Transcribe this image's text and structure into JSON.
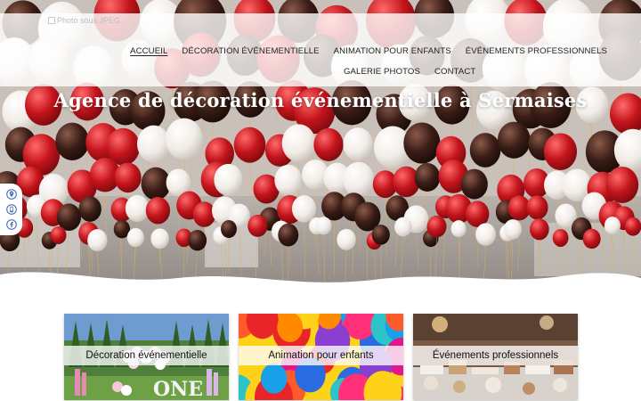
{
  "header": {
    "logo_alt": "Photo sous JPEG"
  },
  "nav": {
    "row1": [
      {
        "label": "Accueil",
        "active": true
      },
      {
        "label": "Décoration événementielle",
        "active": false
      },
      {
        "label": "Animation pour enfants",
        "active": false
      },
      {
        "label": "Événements professionnels",
        "active": false
      }
    ],
    "row2": [
      {
        "label": "Galerie photos",
        "active": false
      },
      {
        "label": "Contact",
        "active": false
      }
    ]
  },
  "hero": {
    "title": "Agence de décoration événementielle à Sermaises",
    "balloon_colors": [
      "#c4141c",
      "#3a1d16",
      "#f3efea"
    ]
  },
  "social": {
    "icons": [
      "map-pin-icon",
      "phone-icon",
      "facebook-icon"
    ],
    "icon_color": "#3b63b5"
  },
  "cards": [
    {
      "label": "Décoration événementielle"
    },
    {
      "label": "Animation pour enfants"
    },
    {
      "label": "Événements professionnels"
    }
  ]
}
